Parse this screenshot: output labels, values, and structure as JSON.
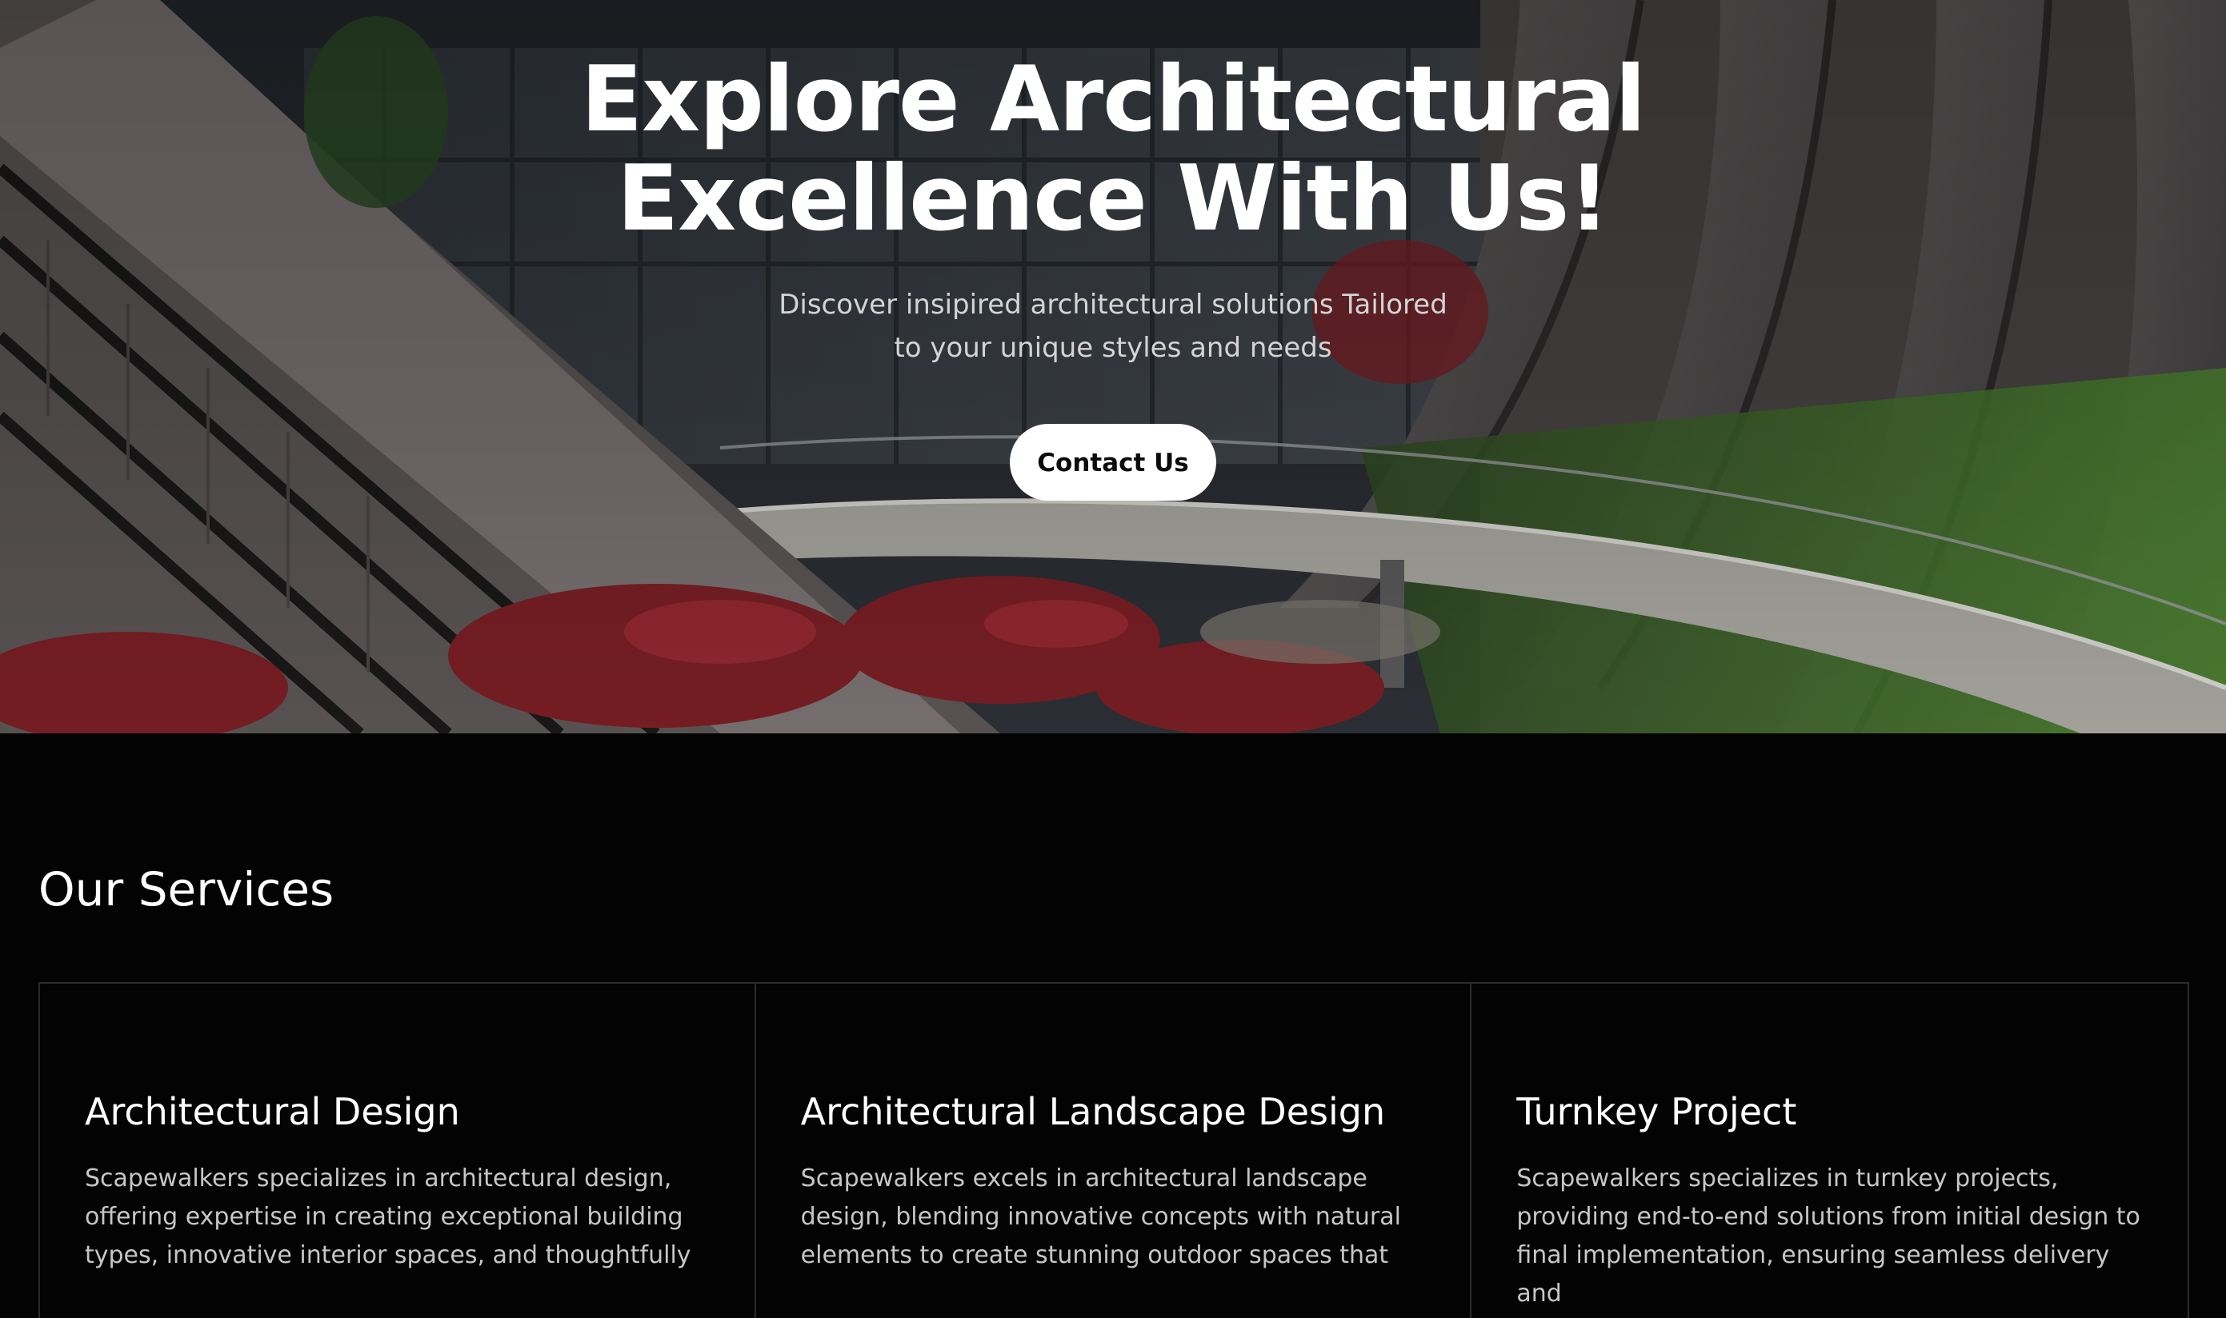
{
  "hero": {
    "title_line1": "Explore Architectural",
    "title_line2": "Excellence With Us!",
    "subtitle_line1": "Discover insipired architectural solutions Tailored",
    "subtitle_line2": "to your unique styles and needs",
    "cta_label": "Contact Us",
    "background_image": "modern curved architecture building with green roof and red foliage"
  },
  "services": {
    "heading": "Our Services",
    "cards": [
      {
        "title": "Architectural Design",
        "description": "Scapewalkers specializes in architectural design, offering expertise in creating exceptional building types, innovative interior spaces, and thoughtfully"
      },
      {
        "title": "Architectural Landscape Design",
        "description": "Scapewalkers excels in architectural landscape design, blending innovative concepts with natural elements to create stunning outdoor spaces that"
      },
      {
        "title": "Turnkey Project",
        "description": "Scapewalkers specializes in turnkey projects, providing end-to-end solutions from initial design to final implementation, ensuring seamless delivery and"
      }
    ]
  },
  "colors": {
    "page_background": "#030303",
    "button_background": "#ffffff",
    "button_text": "#0b0b0b",
    "card_border": "#2b2b2b",
    "body_text": "#c6c6c6"
  }
}
